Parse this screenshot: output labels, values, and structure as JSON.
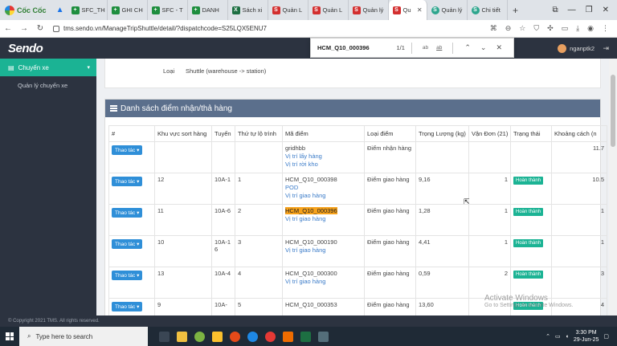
{
  "browser": {
    "brand": "Cốc Cốc",
    "tabs": [
      {
        "label": "SFC_TH",
        "fav": "green",
        "glyph": "+"
      },
      {
        "label": "GHI CH",
        "fav": "green",
        "glyph": "+"
      },
      {
        "label": "SFC - T",
        "fav": "green",
        "glyph": "+"
      },
      {
        "label": "DANH",
        "fav": "green",
        "glyph": "+"
      },
      {
        "label": "Sách xi",
        "fav": "excel",
        "glyph": "X"
      },
      {
        "label": "Quản L",
        "fav": "red",
        "glyph": "S"
      },
      {
        "label": "Quản L",
        "fav": "red",
        "glyph": "S"
      },
      {
        "label": "Quản lý",
        "fav": "red",
        "glyph": "S"
      },
      {
        "label": "Qu",
        "fav": "red",
        "glyph": "S",
        "active": true
      },
      {
        "label": "Quản lý",
        "fav": "teal",
        "glyph": "S"
      },
      {
        "label": "Chi tiết",
        "fav": "teal",
        "glyph": "S"
      }
    ],
    "url": "tms.sendo.vn/ManageTripShuttle/detail/?dispatchcode=S25LQX5ENU7"
  },
  "find": {
    "query": "HCM_Q10_000396",
    "count": "1/1",
    "opt1": "ab",
    "opt2": "ab"
  },
  "header": {
    "logo": "Sendo",
    "user": "nganptk2"
  },
  "sidebar": {
    "menu_label": "Chuyến xe",
    "sub_label": "Quản lý chuyến xe"
  },
  "info": {
    "label": "Loại",
    "value": "Shuttle (warehouse -> station)"
  },
  "panel": {
    "title": "Danh sách điểm nhận/thả hàng"
  },
  "table": {
    "headers": [
      "#",
      "Khu vực sort hàng",
      "Tuyến",
      "Thứ tự lộ trình",
      "Mã điểm",
      "Loại điểm",
      "Trọng Lượng (kg)",
      "Vận Đơn (21)",
      "Trạng thái",
      "Khoảng cách (n"
    ],
    "action_label": "Thao tác",
    "rows": [
      {
        "sort": "",
        "route": "",
        "order": "",
        "code": "gridhbb",
        "links": [
          "Vị trí lấy hàng",
          "Vị trí rời kho"
        ],
        "type": "Điểm nhận hàng",
        "weight": "",
        "waybills": "",
        "status": "",
        "distance": "11.7"
      },
      {
        "sort": "12",
        "route": "10A-1",
        "order": "1",
        "code": "HCM_Q10_000398",
        "links": [
          "POD",
          "Vị trí giao hàng"
        ],
        "type": "Điểm giao hàng",
        "weight": "9,16",
        "waybills": "1",
        "status": "Hoàn thành",
        "distance": "10.5"
      },
      {
        "sort": "11",
        "route": "10A-6",
        "order": "2",
        "code": "HCM_Q10_000396",
        "highlight": true,
        "links": [
          "Vị trí giao hàng"
        ],
        "type": "Điểm giao hàng",
        "weight": "1,28",
        "waybills": "1",
        "status": "Hoàn thành",
        "distance": "1"
      },
      {
        "sort": "10",
        "route": "10A-16",
        "order": "3",
        "code": "HCM_Q10_000190",
        "links": [
          "Vị trí giao hàng"
        ],
        "type": "Điểm giao hàng",
        "weight": "4,41",
        "waybills": "1",
        "status": "Hoàn thành",
        "distance": "1"
      },
      {
        "sort": "13",
        "route": "10A-4",
        "order": "4",
        "code": "HCM_Q10_000300",
        "links": [
          "Vị trí giao hàng"
        ],
        "type": "Điểm giao hàng",
        "weight": "0,59",
        "waybills": "2",
        "status": "Hoàn thành",
        "distance": "3"
      },
      {
        "sort": "9",
        "route": "10A-",
        "order": "5",
        "code": "HCM_Q10_000353",
        "links": [],
        "type": "Điểm giao hàng",
        "weight": "13,60",
        "waybills": "",
        "status": "Hoàn thành",
        "distance": "4"
      }
    ]
  },
  "watermark": {
    "line1": "Activate Windows",
    "line2": "Go to Settings to activate Windows."
  },
  "footer": "© Copyright 2021 TMS. All rights reserved.",
  "taskbar": {
    "search_placeholder": "Type here to search",
    "time": "3:30 PM",
    "date": "29-Jun-25"
  }
}
